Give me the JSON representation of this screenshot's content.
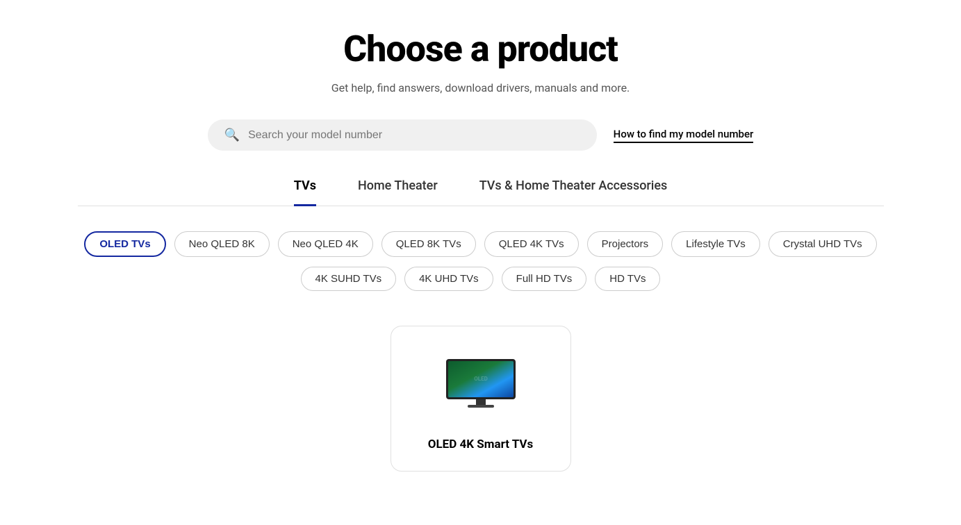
{
  "header": {
    "title": "Choose a product",
    "subtitle": "Get help, find answers, download drivers, manuals and more."
  },
  "search": {
    "placeholder": "Search your model number",
    "model_link": "How to find my model number"
  },
  "tabs": [
    {
      "id": "tvs",
      "label": "TVs",
      "active": true
    },
    {
      "id": "home-theater",
      "label": "Home Theater",
      "active": false
    },
    {
      "id": "accessories",
      "label": "TVs & Home Theater Accessories",
      "active": false
    }
  ],
  "filters_row1": [
    {
      "id": "oled-tvs",
      "label": "OLED TVs",
      "active": true
    },
    {
      "id": "neo-qled-8k",
      "label": "Neo QLED 8K",
      "active": false
    },
    {
      "id": "neo-qled-4k",
      "label": "Neo QLED 4K",
      "active": false
    },
    {
      "id": "qled-8k-tvs",
      "label": "QLED 8K TVs",
      "active": false
    },
    {
      "id": "qled-4k-tvs",
      "label": "QLED 4K TVs",
      "active": false
    },
    {
      "id": "projectors",
      "label": "Projectors",
      "active": false
    },
    {
      "id": "lifestyle-tvs",
      "label": "Lifestyle TVs",
      "active": false
    },
    {
      "id": "crystal-uhd-tvs",
      "label": "Crystal UHD TVs",
      "active": false
    }
  ],
  "filters_row2": [
    {
      "id": "4k-suhd-tvs",
      "label": "4K SUHD TVs",
      "active": false
    },
    {
      "id": "4k-uhd-tvs",
      "label": "4K UHD TVs",
      "active": false
    },
    {
      "id": "full-hd-tvs",
      "label": "Full HD TVs",
      "active": false
    },
    {
      "id": "hd-tvs",
      "label": "HD TVs",
      "active": false
    }
  ],
  "products": [
    {
      "id": "oled-4k-smart-tvs",
      "name": "OLED 4K Smart TVs"
    }
  ],
  "colors": {
    "accent": "#1428A0"
  }
}
